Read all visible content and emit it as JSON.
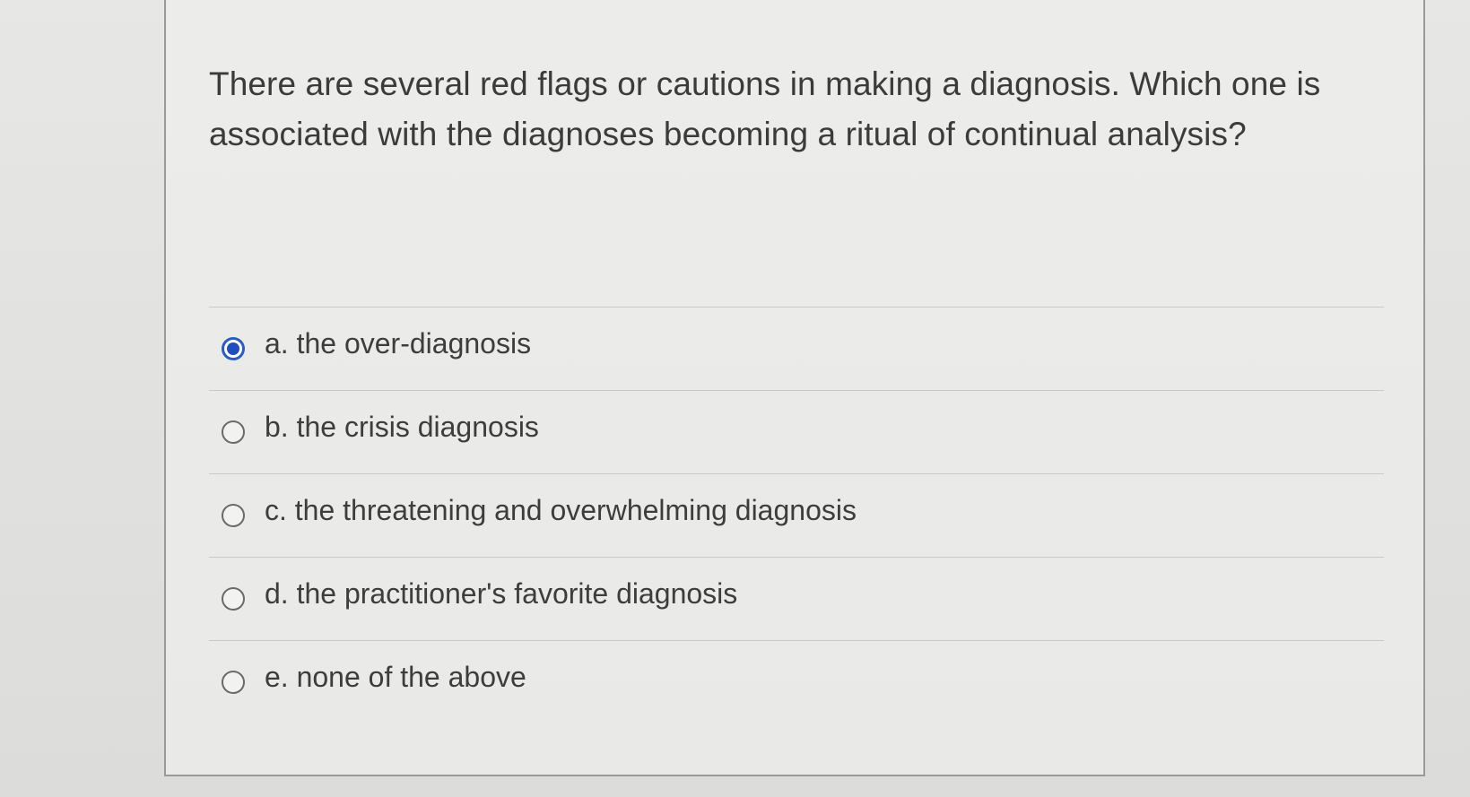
{
  "question": {
    "text": "There are several red flags or cautions in making a diagnosis. Which one is associated with the diagnoses becoming a ritual of continual analysis?"
  },
  "options": [
    {
      "label": "a. the over-diagnosis",
      "selected": true
    },
    {
      "label": "b. the crisis diagnosis",
      "selected": false
    },
    {
      "label": "c. the threatening and overwhelming diagnosis",
      "selected": false
    },
    {
      "label": "d. the practitioner's favorite diagnosis",
      "selected": false
    },
    {
      "label": "e. none of the above",
      "selected": false
    }
  ],
  "colors": {
    "selected_radio": "#1f4fbf",
    "text": "#3b3b3b",
    "card_border": "#9a9a98"
  }
}
